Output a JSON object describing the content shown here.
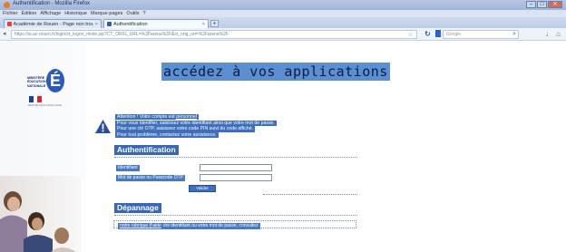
{
  "window": {
    "title": "Authentification - Mozilla Firefox",
    "controls": {
      "minimize": "–",
      "maximize": "□",
      "close": "✕"
    }
  },
  "menu": [
    "Fichier",
    "Édition",
    "Affichage",
    "Historique",
    "Marque-pages",
    "Outils",
    "?"
  ],
  "tabs": [
    {
      "label": "Académie de Rouen - Page non trouvée",
      "active": false
    },
    {
      "label": "Authentification",
      "active": true
    }
  ],
  "newtab_label": "+",
  "url": "https://si.ac-rouen.fr/login/ct_logon_mixte.jsp?CT_ORIG_URL=%2Farena%2F&ct_orig_uri=%2Farena%2F",
  "search": {
    "placeholder": "Google"
  },
  "page": {
    "logo": {
      "lines": [
        "MINISTÈRE",
        "ÉDUCATION",
        "NATIONALE"
      ],
      "letter": "É",
      "flag_caption": "RÉPUBLIQUE FRANÇAISE"
    },
    "heading": "accédez à vos applications",
    "info": {
      "line1": "Attention ! Votre compte est",
      "line1_link": "personnel",
      "line2": "Pour vous identifier, saisissez votre identifiant ainsi que votre mot de passe.",
      "line3": "Pour une clé OTP, saisissez votre code PIN suivi du code affiché.",
      "line4": "Pour tout problème, contactez votre assistance."
    },
    "auth": {
      "title": "Authentification",
      "username_label": "Identifiant",
      "password_label": "Mot de passe ou Passcode OTP",
      "submit_label": "Valider"
    },
    "depannage": {
      "title": "Dépannage",
      "text": "Si vous avez perdu votre identifiant ou votre mot de passe, consultez",
      "link": "notre rubrique d'aide"
    }
  },
  "colors": {
    "accent": "#3a67b5",
    "heading_bg": "#5b8fd1",
    "logo_blue": "#2a59b8",
    "warning": "#2a4f9a"
  }
}
